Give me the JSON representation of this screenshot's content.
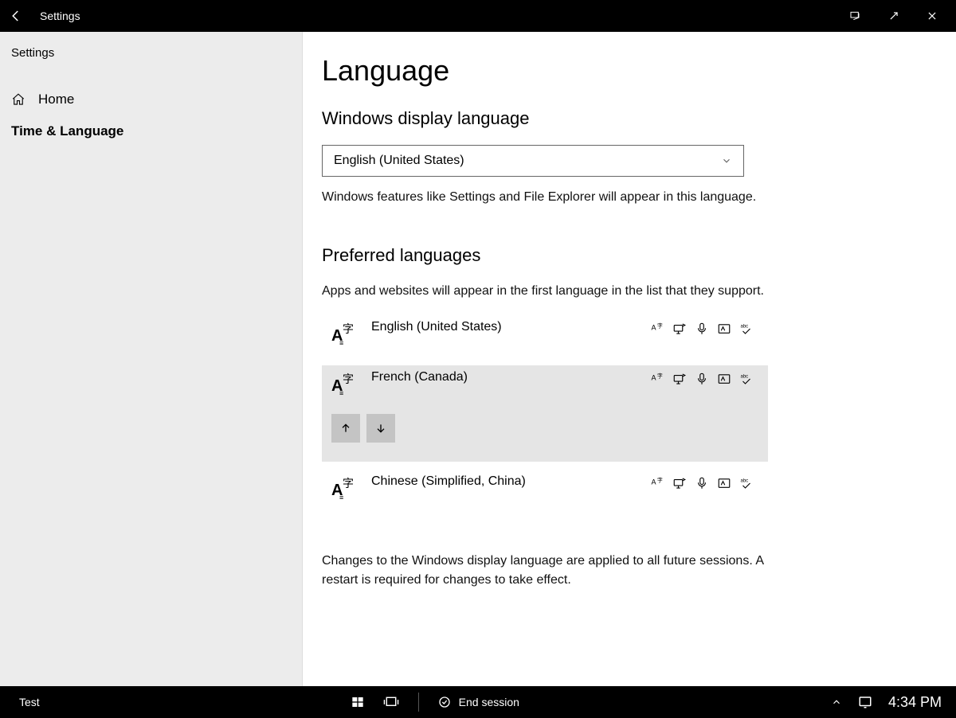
{
  "titlebar": {
    "title": "Settings"
  },
  "sidebar": {
    "header": "Settings",
    "home_label": "Home",
    "selected_label": "Time & Language"
  },
  "page": {
    "title": "Language",
    "display_section_title": "Windows display language",
    "display_dropdown_value": "English (United States)",
    "display_description": "Windows features like Settings and File Explorer will appear in this language.",
    "preferred_section_title": "Preferred languages",
    "preferred_description": "Apps and websites will appear in the first language in the list that they support.",
    "languages": [
      {
        "name": "English (United States)",
        "selected": false
      },
      {
        "name": "French (Canada)",
        "selected": true
      },
      {
        "name": "Chinese (Simplified, China)",
        "selected": false
      }
    ],
    "footer_note": "Changes to the Windows display language are applied to all future sessions. A restart is required for changes to take effect."
  },
  "taskbar": {
    "label": "Test",
    "end_session_label": "End session",
    "clock": "4:34 PM"
  }
}
